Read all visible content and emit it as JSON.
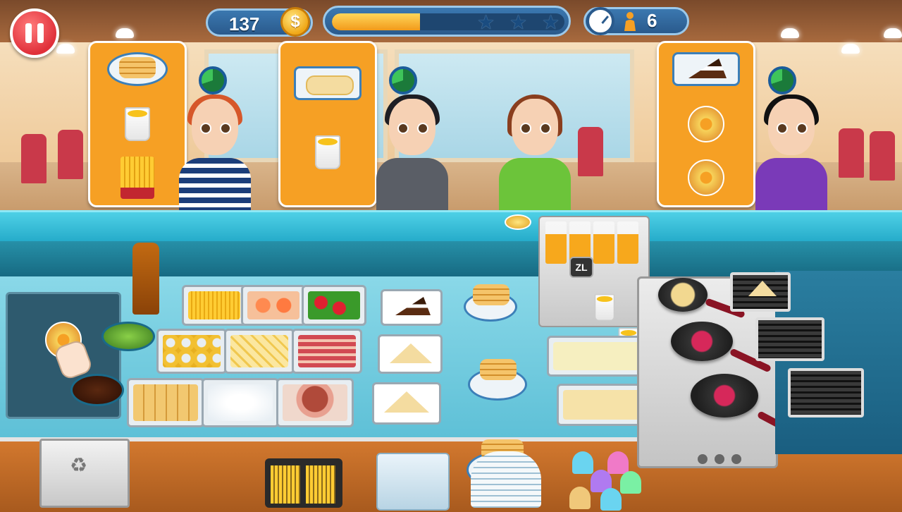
{
  "hud": {
    "coins": "137",
    "coin_symbol": "$",
    "level_progress": 0.38,
    "stars_total": 3,
    "stars_earned": 0,
    "customers_left": "6"
  },
  "controls": {
    "zl_hint": "ZL"
  },
  "orders": [
    {
      "items": [
        "pancakes-with-banana",
        "orange-juice",
        "fries"
      ],
      "timer_remaining": 0.7
    },
    {
      "items": [
        "crepe-with-banana-strawberry",
        "orange-juice"
      ],
      "timer_remaining": 0.7
    },
    {
      "items": [
        "chocolate-cake-slice",
        "donut",
        "donut"
      ],
      "timer_remaining": 0.7
    }
  ],
  "colors": {
    "accent": "#f6a024",
    "counter": "#22a9c8",
    "hud_panel": "#2a5a8c",
    "pause": "#e0303a"
  }
}
